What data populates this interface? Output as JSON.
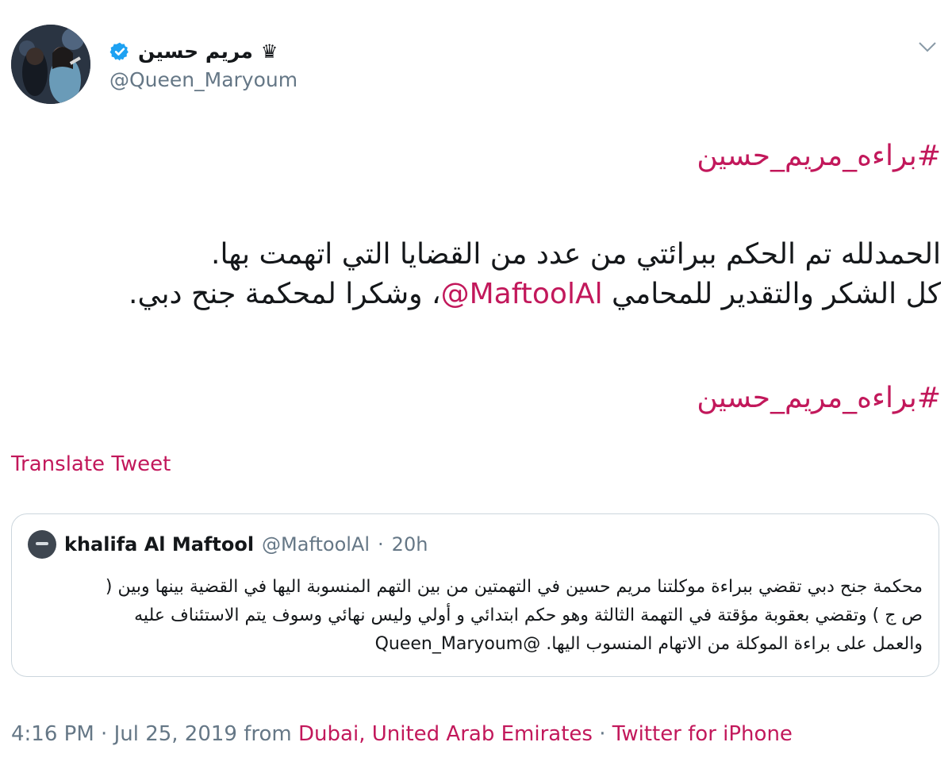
{
  "author": {
    "display_name": "مريم حسين",
    "crown": "♛",
    "handle": "@Queen_Maryoum"
  },
  "tweet": {
    "hashtag_top": "#براءه_مريم_حسين",
    "line1": "الحمدلله تم الحكم ببرائتي من عدد من القضايا التي اتهمت بها.",
    "line2_before": "كل الشكر والتقدير للمحامي ",
    "line2_mention": "@MaftoolAl",
    "line2_after": "، وشكرا لمحكمة جنح دبي.",
    "hashtag_bottom": "#براءه_مريم_حسين",
    "translate_label": "Translate Tweet"
  },
  "quoted_tweet": {
    "name": "khalifa Al Maftool",
    "handle": "@MaftoolAl",
    "separator": "·",
    "time": "20h",
    "line1": "محكمة جنح دبي تقضي ببراءة موكلتنا مريم حسين في التهمتين من بين التهم المنسوبة اليها في القضية بينها وبين (",
    "line2": "ص ج ) وتقضي بعقوبة مؤقتة في التهمة الثالثة وهو حكم ابتدائي و أولي وليس نهائي وسوف يتم الاستئناف عليه",
    "line3": "والعمل على براءة الموكلة من الاتهام المنسوب اليها. @Queen_Maryoum"
  },
  "footer": {
    "time": "4:16 PM",
    "sep1": " · ",
    "date": "Jul 25, 2019",
    "from": " from ",
    "location": "Dubai, United Arab Emirates",
    "sep2": " · ",
    "source": "Twitter for iPhone"
  },
  "colors": {
    "accent": "#c2185b",
    "verified": "#1da1f2",
    "muted": "#657786",
    "text": "#14171a",
    "border": "#ccd6dd"
  },
  "icons": {
    "verified": "verified-badge-icon",
    "caret": "chevron-down-icon"
  }
}
